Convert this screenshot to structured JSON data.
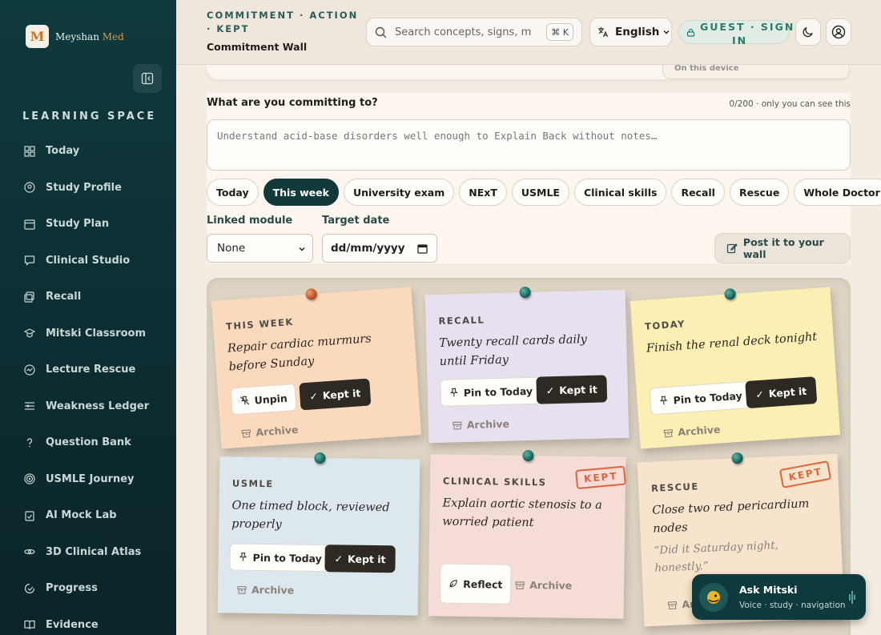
{
  "app": {
    "brand_first": "Meyshan",
    "brand_second": "Med",
    "logo_letter": "M"
  },
  "sidebar": {
    "section_title": "LEARNING SPACE",
    "items": [
      {
        "label": "Today",
        "icon": "grid-icon"
      },
      {
        "label": "Study Profile",
        "icon": "user-circle-icon"
      },
      {
        "label": "Study Plan",
        "icon": "calendar-icon"
      },
      {
        "label": "Clinical Studio",
        "icon": "chat-icon"
      },
      {
        "label": "Recall",
        "icon": "cards-icon"
      },
      {
        "label": "Mitski Classroom",
        "icon": "graduation-cap-icon"
      },
      {
        "label": "Lecture Rescue",
        "icon": "lifebuoy-icon"
      },
      {
        "label": "Weakness Ledger",
        "icon": "list-icon"
      },
      {
        "label": "Question Bank",
        "icon": "question-icon"
      },
      {
        "label": "USMLE Journey",
        "icon": "target-icon"
      },
      {
        "label": "AI Mock Lab",
        "icon": "clipboard-icon"
      },
      {
        "label": "3D Clinical Atlas",
        "icon": "atom-icon"
      },
      {
        "label": "Progress",
        "icon": "progress-icon"
      },
      {
        "label": "Evidence",
        "icon": "book-icon"
      }
    ]
  },
  "header": {
    "breadcrumb": "COMMITMENT · ACTION · KEPT",
    "title": "Commitment Wall",
    "search_placeholder": "Search concepts, signs, mec",
    "search_shortcut": "⌘ K",
    "language": "English",
    "guest_line1": "GUEST · SIGN",
    "guest_line2": "IN"
  },
  "top_card": {
    "chip_text": "On this device"
  },
  "form": {
    "question": "What are you committing to?",
    "counter": "0/200 · only you can see this",
    "placeholder": "Understand acid-base disorders well enough to Explain Back without notes…",
    "chips": [
      "Today",
      "This week",
      "University exam",
      "NExT",
      "USMLE",
      "Clinical skills",
      "Recall",
      "Rescue",
      "Whole Doctor"
    ],
    "active_chip": "This week",
    "linked_module_label": "Linked module",
    "linked_module_value": "None",
    "target_date_label": "Target date",
    "target_date_value": "dd/mm/yyyy",
    "post_button": "Post it to your wall"
  },
  "notes": [
    {
      "tag": "THIS WEEK",
      "text": "Repair cardiac murmurs before Sunday",
      "btn1": "Unpin",
      "btn2": "Kept it",
      "archive": "Archive",
      "color": "#fbd9bd",
      "pin": "orange"
    },
    {
      "tag": "RECALL",
      "text": "Twenty recall cards daily until Friday",
      "btn1": "Pin to Today",
      "btn2": "Kept it",
      "archive": "Archive",
      "color": "#e6e0ef",
      "pin": "teal"
    },
    {
      "tag": "TODAY",
      "text": "Finish the renal deck tonight",
      "btn1": "Pin to Today",
      "btn2": "Kept it",
      "archive": "Archive",
      "color": "#fbefb3",
      "pin": "teal"
    },
    {
      "tag": "USMLE",
      "text": "One timed block, reviewed properly",
      "btn1": "Pin to Today",
      "btn2": "Kept it",
      "archive": "Archive",
      "color": "#dde7ee",
      "pin": "teal"
    },
    {
      "tag": "CLINICAL SKILLS",
      "text": "Explain aortic stenosis to a worried patient",
      "btn1": "Reflect",
      "archive": "Archive",
      "stamp": "KEPT",
      "color": "#f6dcd6",
      "pin": "teal"
    },
    {
      "tag": "RESCUE",
      "text": "Close two red pericardium nodes",
      "quote": "“Did it Saturday night, honestly.”",
      "archive": "Archive",
      "stamp": "KEPT",
      "color": "#f8e4cc",
      "pin": "teal"
    }
  ],
  "assistant": {
    "title": "Ask Mitski",
    "subtitle": "Voice · study · navigation"
  },
  "colors": {
    "sidebar_bg": "#0f3a3d",
    "accent_teal": "#2c7a6e",
    "kept_stamp": "#e0643a",
    "dark_button": "#2f2924"
  }
}
